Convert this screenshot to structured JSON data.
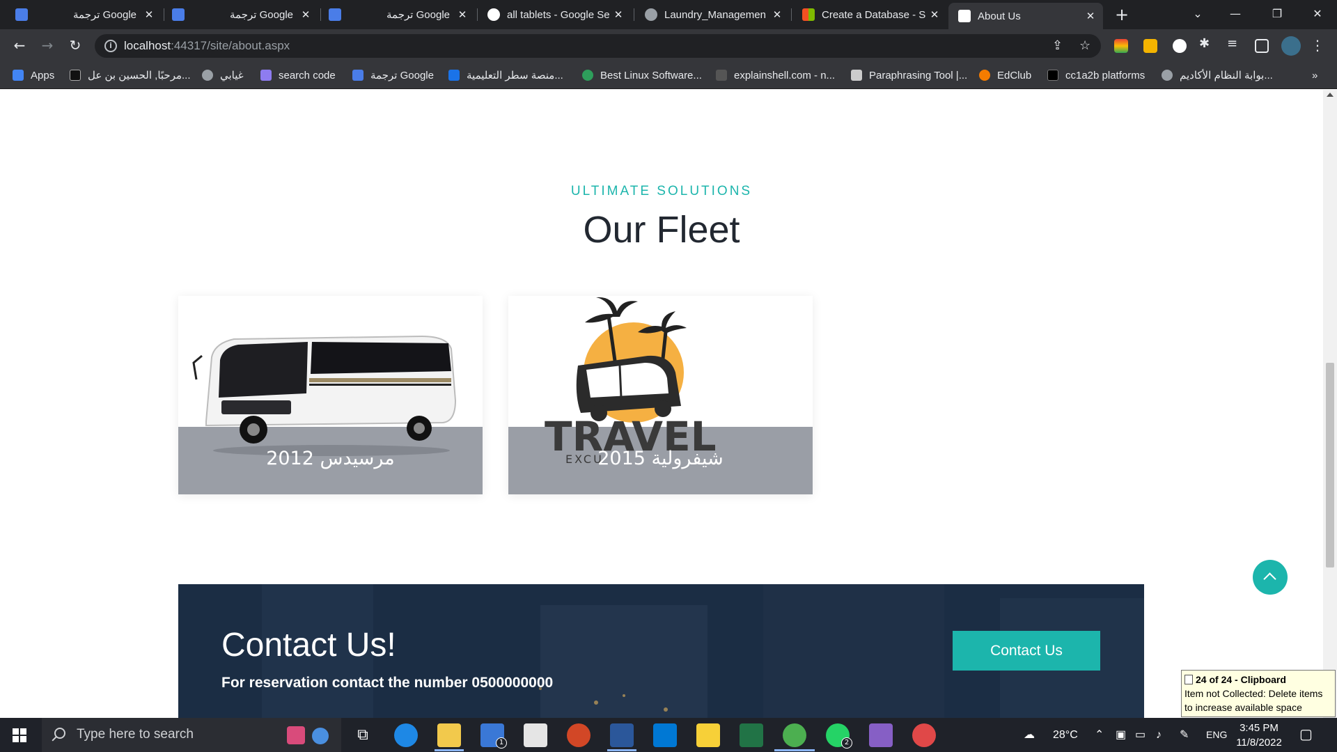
{
  "browser": {
    "tabs": [
      {
        "label": "ترجمة Google",
        "active": false
      },
      {
        "label": "ترجمة Google",
        "active": false
      },
      {
        "label": "ترجمة Google",
        "active": false
      },
      {
        "label": "all tablets - Google Se",
        "active": false
      },
      {
        "label": "Laundry_Managemen",
        "active": false
      },
      {
        "label": "Create a Database - S",
        "active": false
      },
      {
        "label": "About Us",
        "active": true
      }
    ],
    "url_host": "localhost",
    "url_rest": ":44317/site/about.aspx"
  },
  "bookmarks": [
    {
      "label": "Apps"
    },
    {
      "label": "مرحبًا, الحسين بن عل..."
    },
    {
      "label": "غيابي"
    },
    {
      "label": "search code"
    },
    {
      "label": "ترجمة Google"
    },
    {
      "label": "منصة سطر التعليمية..."
    },
    {
      "label": "Best Linux Software..."
    },
    {
      "label": "explainshell.com - n..."
    },
    {
      "label": "Paraphrasing Tool |..."
    },
    {
      "label": "EdClub"
    },
    {
      "label": "cc1a2b platforms"
    },
    {
      "label": "بوابة النظام الأكاديم..."
    }
  ],
  "fleet": {
    "subtitle": "ULTIMATE SOLUTIONS",
    "title": "Our Fleet",
    "cards": [
      {
        "caption": "مرسيدس 2012"
      },
      {
        "caption": "شيفرولية 2015",
        "logo_text": "TRAVEL",
        "logo_sub": "EXCU"
      }
    ]
  },
  "contact": {
    "title": "Contact Us!",
    "text": "For reservation contact the number 0500000000",
    "button": "Contact Us"
  },
  "clipboard_tip": {
    "title": "24 of 24 - Clipboard",
    "body": "Item not Collected: Delete items to increase available space"
  },
  "taskbar": {
    "search_placeholder": "Type here to search",
    "mail_badge": "1",
    "whatsapp_badge": "2",
    "weather": "28°C",
    "lang": "ENG",
    "time": "3:45 PM",
    "date": "11/8/2022"
  },
  "colors": {
    "accent": "#1cb5ac",
    "title": "#222831",
    "contact_bg": "#1b2d44",
    "card_band": "#9a9ea6"
  }
}
